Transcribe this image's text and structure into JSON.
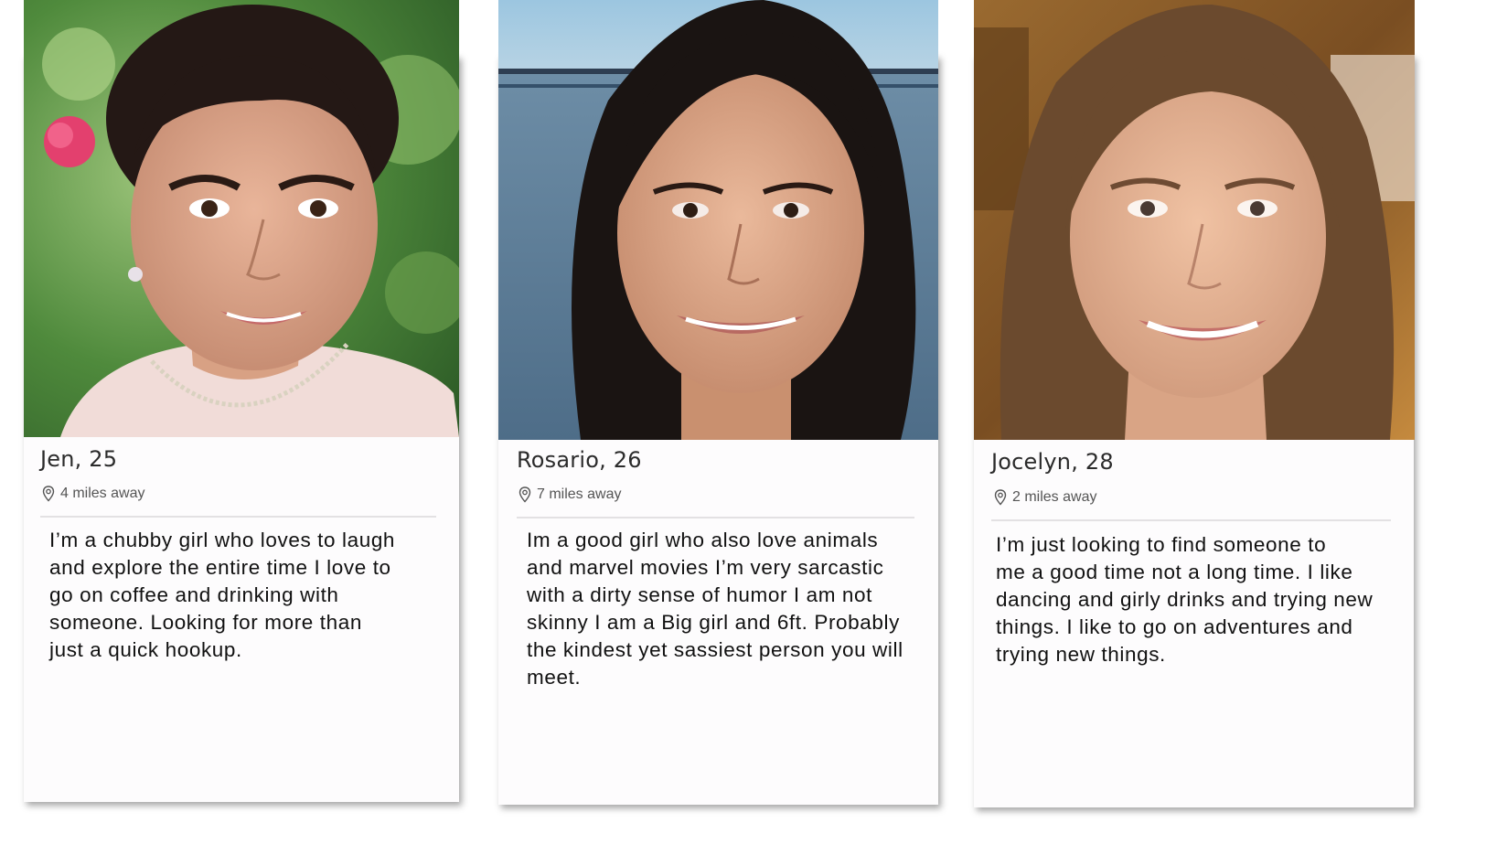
{
  "profiles": [
    {
      "name_age": "Jen, 25",
      "distance": "4 miles away",
      "bio": "I’m a chubby girl who loves to laugh\nand explore the entire time  I love to\ngo on coffee and drinking with\nsomeone.  Looking for more than\njust a quick hookup."
    },
    {
      "name_age": "Rosario, 26",
      "distance": "7 miles away",
      "bio": "Im a good girl who also love animals\nand marvel movies  I’m very sarcastic\nwith a dirty sense of humor  I am not\nskinny I am a Big girl and 6ft.  Probably\nthe kindest yet sassiest person you will\nmeet."
    },
    {
      "name_age": "Jocelyn, 28",
      "distance": "2 miles away",
      "bio": "I’m just looking to find someone to\nme a good time not a long time.  I like\ndancing and girly drinks and trying new\nthings. I like to go on adventures and\ntrying new things."
    }
  ],
  "icons": {
    "distance": "location-pin-icon"
  }
}
